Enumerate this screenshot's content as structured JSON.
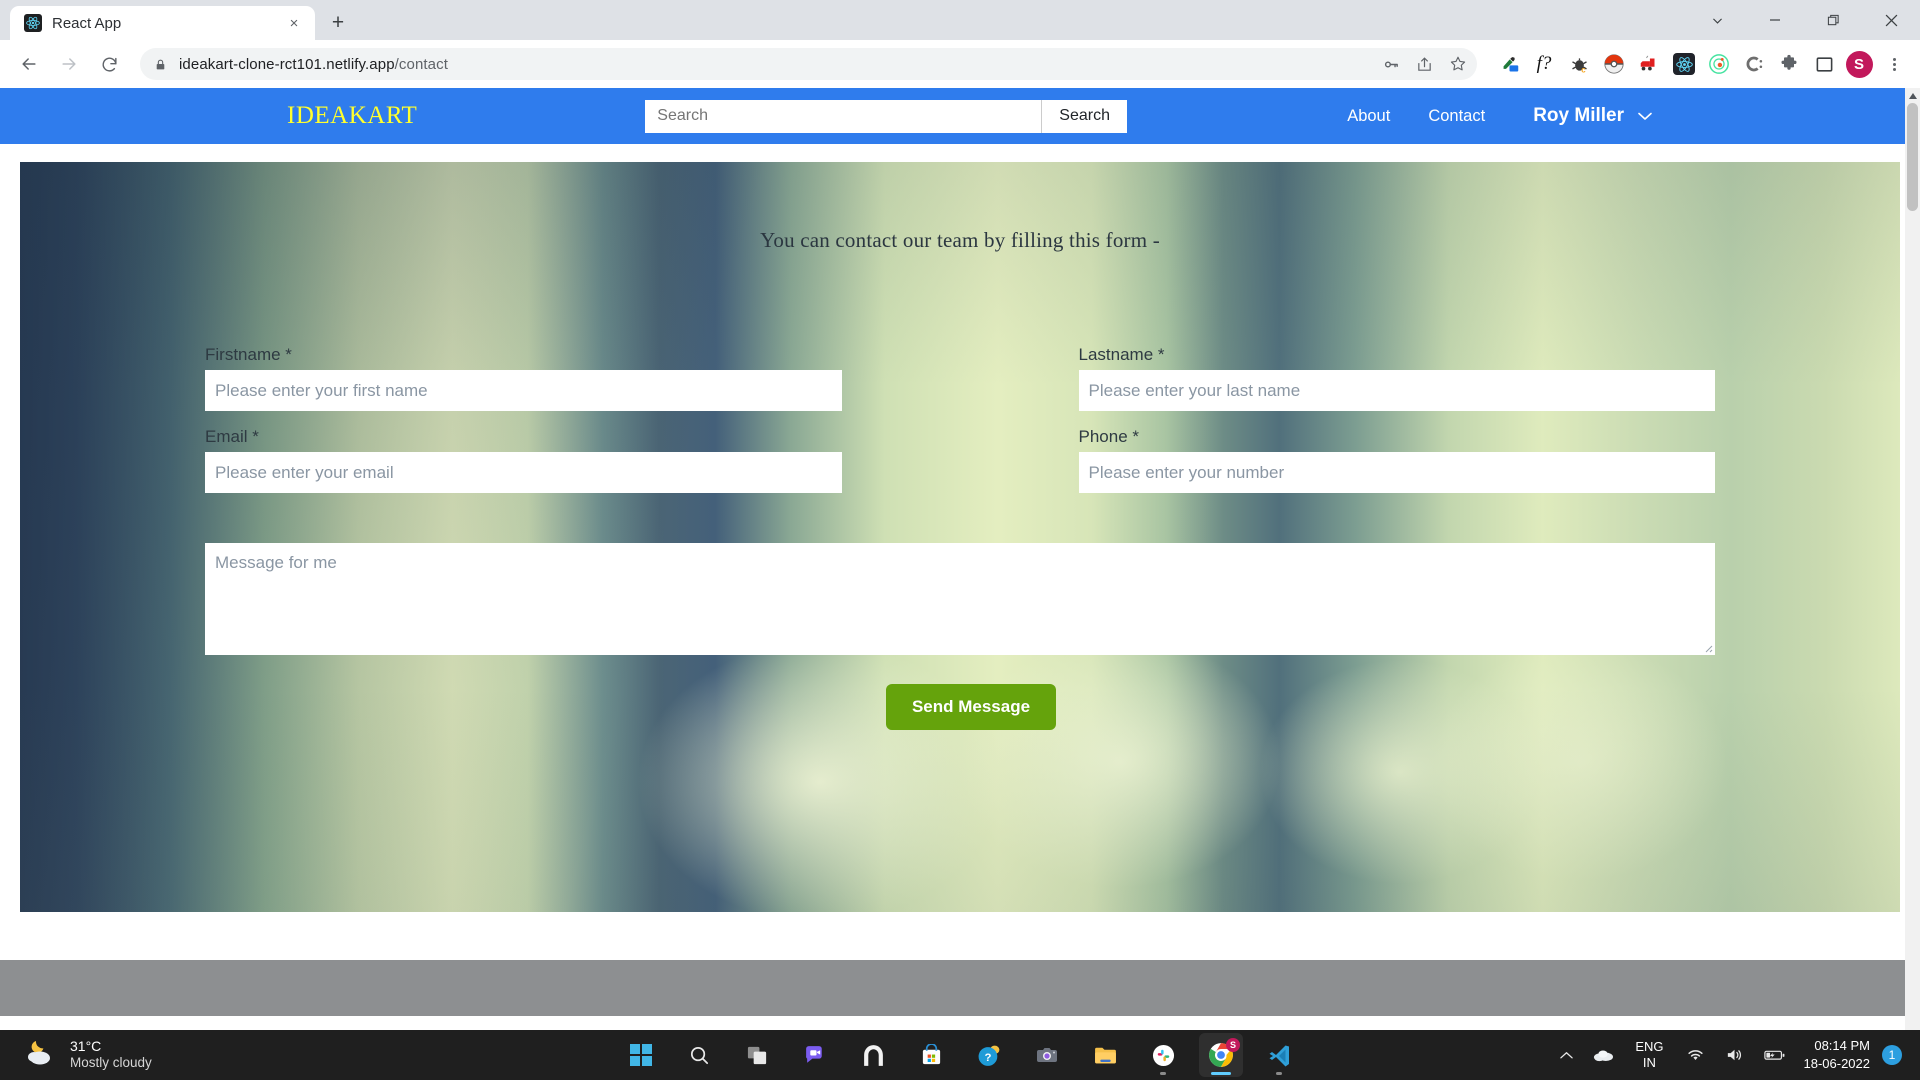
{
  "browser": {
    "tab": {
      "title": "React App",
      "favicon": "react-logo-icon",
      "close": "×"
    },
    "new_tab_label": "+",
    "window_controls": {
      "tab_search": "⌄",
      "minimize": "—",
      "maximize": "❐",
      "close": "✕"
    },
    "nav": {
      "back": "←",
      "forward": "→",
      "reload": "⟳"
    },
    "omnibox": {
      "lock": "lock-icon",
      "url_main": "ideakart-clone-rct101.netlify.app",
      "url_path": "/contact",
      "actions": [
        "password-key-icon",
        "share-icon",
        "bookmark-star-icon"
      ]
    },
    "extensions": [
      "eyedropper-icon",
      "fx-function-icon",
      "bug-console-icon",
      "pokeball-icon",
      "red-train-icon",
      "react-devtools-icon",
      "green-atom-icon",
      "c-colon-icon",
      "puzzle-extensions-icon",
      "sidepanel-icon"
    ],
    "profile_initial": "S",
    "menu": "three-dot-menu-icon"
  },
  "site": {
    "brand": "IDEAKART",
    "brand_color": "#ffff2e",
    "header_color": "#2f7ced",
    "search": {
      "placeholder": "Search",
      "value": "",
      "button_label": "Search"
    },
    "nav_links": [
      "About",
      "Contact"
    ],
    "user": {
      "name": "Roy Miller",
      "caret": "⌄"
    }
  },
  "contact": {
    "heading": "You can contact our team by filling this form -",
    "fields": [
      {
        "label": "Firstname *",
        "placeholder": "Please enter your first name",
        "value": "",
        "name": "firstname"
      },
      {
        "label": "Lastname *",
        "placeholder": "Please enter your last name",
        "value": "",
        "name": "lastname"
      },
      {
        "label": "Email *",
        "placeholder": "Please enter your email",
        "value": "",
        "name": "email"
      },
      {
        "label": "Phone *",
        "placeholder": "Please enter your number",
        "value": "",
        "name": "phone"
      }
    ],
    "message": {
      "placeholder": "Message for me",
      "value": ""
    },
    "submit_label": "Send Message",
    "submit_color": "#65a30c"
  },
  "taskbar": {
    "weather": {
      "temperature": "31°C",
      "description": "Mostly cloudy",
      "icon": "moon-cloud-icon"
    },
    "apps": [
      "start-windows-icon",
      "search-icon",
      "task-view-icon",
      "chat-teams-icon",
      "widgets-icon",
      "microsoft-store-icon",
      "help-tips-icon",
      "camera-icon",
      "file-explorer-icon",
      "slack-icon",
      "google-chrome-icon",
      "vs-code-icon"
    ],
    "tray": {
      "chevron": "⌃",
      "cloud": "onedrive-icon",
      "language_top": "ENG",
      "language_bottom": "IN",
      "wifi": "wifi-icon",
      "volume": "speaker-icon",
      "battery": "battery-charging-icon",
      "time": "08:14 PM",
      "date": "18-06-2022",
      "notification_count": "1"
    }
  }
}
